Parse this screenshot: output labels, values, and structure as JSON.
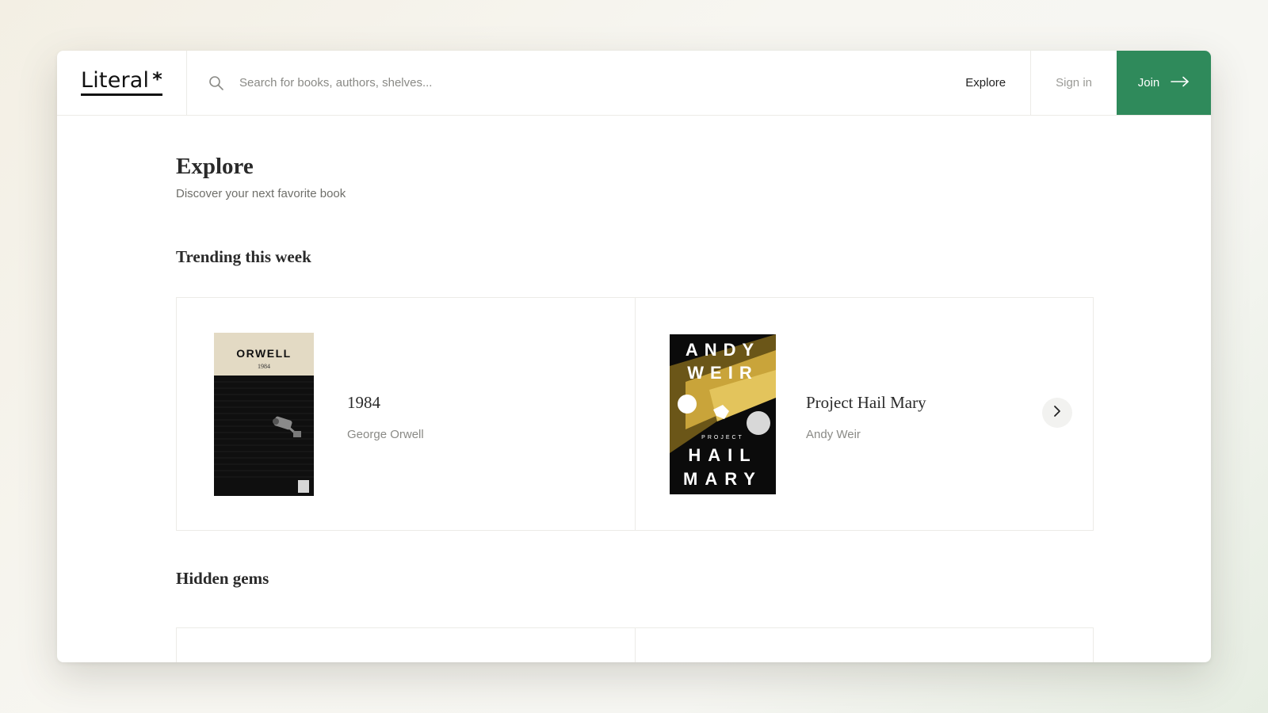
{
  "header": {
    "logo_text": "Literal",
    "logo_mark": "*",
    "search_placeholder": "Search for books, authors, shelves...",
    "nav_explore": "Explore",
    "nav_signin": "Sign in",
    "join_label": "Join",
    "join_icon": "arrow-right-icon"
  },
  "page": {
    "title": "Explore",
    "subtitle": "Discover your next favorite book"
  },
  "sections": [
    {
      "title": "Trending this week",
      "books": [
        {
          "title": "1984",
          "author": "George Orwell",
          "cover": {
            "top_text": "ORWELL",
            "sub_text": "1984",
            "bg": "#0f0f0f",
            "band": "#e3dac4"
          }
        },
        {
          "title": "Project Hail Mary",
          "author": "Andy Weir",
          "cover": {
            "line1": "ANDY",
            "line2": "WEIR",
            "line3": "PROJECT",
            "line4": "HAIL",
            "line5": "MARY",
            "bg": "#0b0b0b",
            "accent": "#c9a43a"
          }
        }
      ],
      "next_icon": "chevron-right-icon"
    },
    {
      "title": "Hidden gems"
    }
  ],
  "colors": {
    "accent": "#2f8a5b",
    "border": "#ecebe7",
    "text": "#2a2a2a",
    "muted": "#8a8a86"
  }
}
